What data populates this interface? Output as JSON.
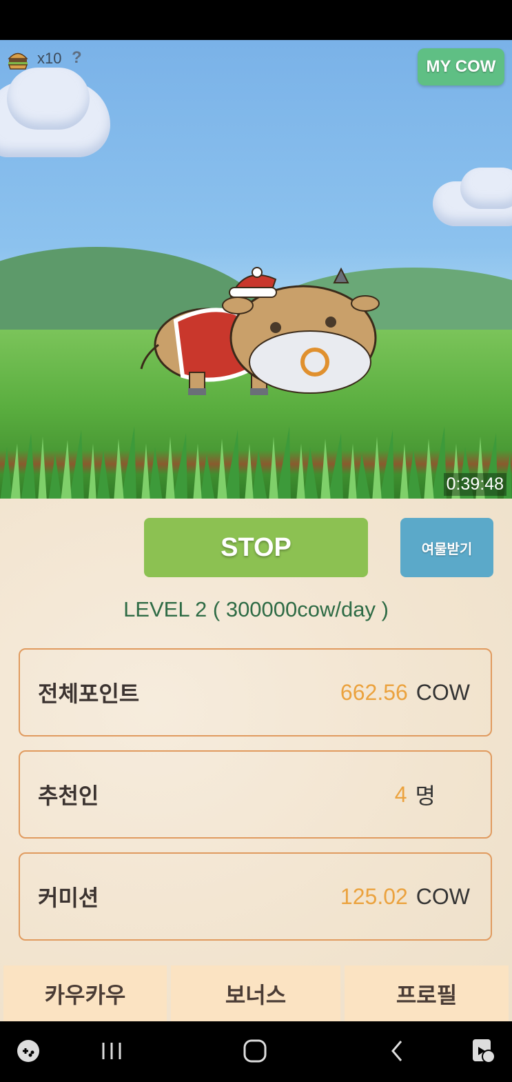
{
  "hud": {
    "burger_count": "x10",
    "help": "?",
    "my_cow_label": "MY COW"
  },
  "timer": "0:39:48",
  "controls": {
    "stop_label": "STOP",
    "reward_label": "여물받기"
  },
  "level_text": "LEVEL  2 ( 300000cow/day )",
  "stats": {
    "total_points": {
      "label": "전체포인트",
      "value": "662.56",
      "unit": "COW"
    },
    "referrals": {
      "label": "추천인",
      "value": "4",
      "unit": "명"
    },
    "commission": {
      "label": "커미션",
      "value": "125.02",
      "unit": "COW"
    }
  },
  "tabs": [
    {
      "label": "카우카우"
    },
    {
      "label": "보너스"
    },
    {
      "label": "프로필"
    }
  ],
  "icons": {
    "burger": "burger-icon",
    "nav": [
      "game-launcher-icon",
      "recent-apps-icon",
      "home-icon",
      "back-icon",
      "screenshot-icon"
    ]
  }
}
